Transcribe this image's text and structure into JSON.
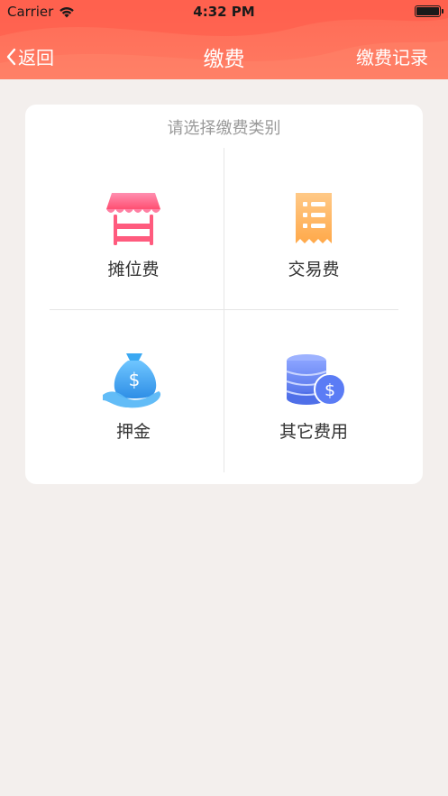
{
  "status_bar": {
    "carrier": "Carrier",
    "time": "4:32 PM"
  },
  "nav": {
    "back_label": "返回",
    "title": "缴费",
    "right_action": "缴费记录"
  },
  "card": {
    "title": "请选择缴费类别",
    "options": [
      {
        "label": "摊位费",
        "icon": "stall-icon"
      },
      {
        "label": "交易费",
        "icon": "receipt-icon"
      },
      {
        "label": "押金",
        "icon": "money-bag-icon"
      },
      {
        "label": "其它费用",
        "icon": "coins-icon"
      }
    ]
  },
  "colors": {
    "header": "#ff6a55",
    "background": "#f3efed",
    "stall": "#ff5b7e",
    "receipt": "#ffb457",
    "money_bag": "#3aa8f2",
    "coins": "#5b7cf5"
  }
}
